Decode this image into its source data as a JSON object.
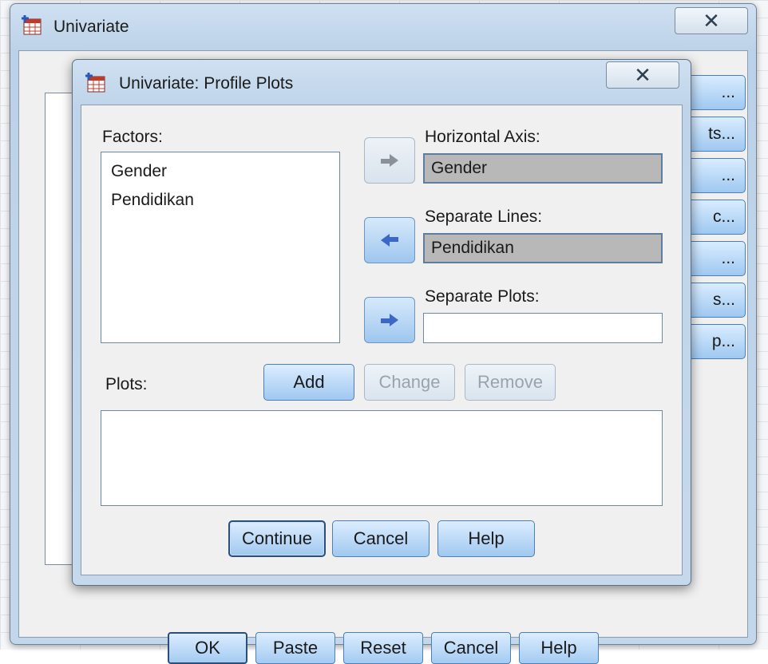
{
  "parent_window": {
    "title": "Univariate",
    "close_glyph": "✕",
    "side_buttons": [
      "...",
      "ts...",
      "...",
      "c...",
      "...",
      "s...",
      "p..."
    ],
    "bottom_buttons": [
      "OK",
      "Paste",
      "Reset",
      "Cancel",
      "Help"
    ]
  },
  "dialog": {
    "title": "Univariate: Profile Plots",
    "close_glyph": "✕",
    "factors_label": "Factors:",
    "factors": [
      "Gender",
      "Pendidikan"
    ],
    "horizontal_axis_label": "Horizontal Axis:",
    "horizontal_axis_value": "Gender",
    "separate_lines_label": "Separate Lines:",
    "separate_lines_value": "Pendidikan",
    "separate_plots_label": "Separate Plots:",
    "separate_plots_value": "",
    "plots_label": "Plots:",
    "add_label": "Add",
    "change_label": "Change",
    "remove_label": "Remove",
    "continue_label": "Continue",
    "cancel_label": "Cancel",
    "help_label": "Help"
  },
  "colors": {
    "accent_blue": "#a0c8f0",
    "arrow_blue": "#3b67c9",
    "arrow_disabled": "#8a9199",
    "filled_field_gray": "#b8b8b8"
  },
  "icons": {
    "app_icon": "spss-table-icon",
    "arrow_horizontal_axis": "move-right-arrow-icon",
    "arrow_separate_lines": "move-left-arrow-icon",
    "arrow_separate_plots": "move-right-arrow-icon"
  }
}
